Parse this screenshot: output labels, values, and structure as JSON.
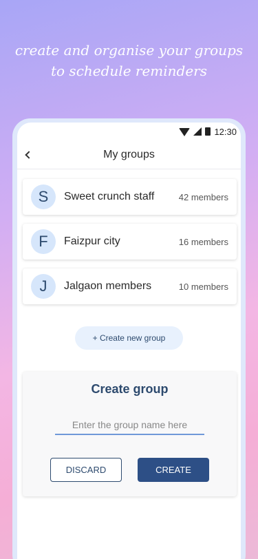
{
  "headline": {
    "line1": "create and organise your groups",
    "line2": "to schedule reminders"
  },
  "status_bar": {
    "time": "12:30",
    "icons": [
      "wifi-icon",
      "signal-icon",
      "battery-icon"
    ]
  },
  "app_bar": {
    "title": "My groups",
    "back_icon": "chevron-left-icon"
  },
  "groups": [
    {
      "initial": "S",
      "name": "Sweet crunch staff",
      "members": "42 members"
    },
    {
      "initial": "F",
      "name": "Faizpur city",
      "members": "16 members"
    },
    {
      "initial": "J",
      "name": "Jalgaon members",
      "members": "10 members"
    }
  ],
  "create_new_button": "+ Create new group",
  "create_panel": {
    "title": "Create group",
    "input_placeholder": "Enter the group name here",
    "input_value": "",
    "discard_label": "DISCARD",
    "create_label": "CREATE"
  },
  "colors": {
    "primary": "#2d4f86",
    "avatar_bg": "#d6e6fb",
    "chip_bg": "#e8f1fd",
    "input_underline": "#6f98d8"
  }
}
